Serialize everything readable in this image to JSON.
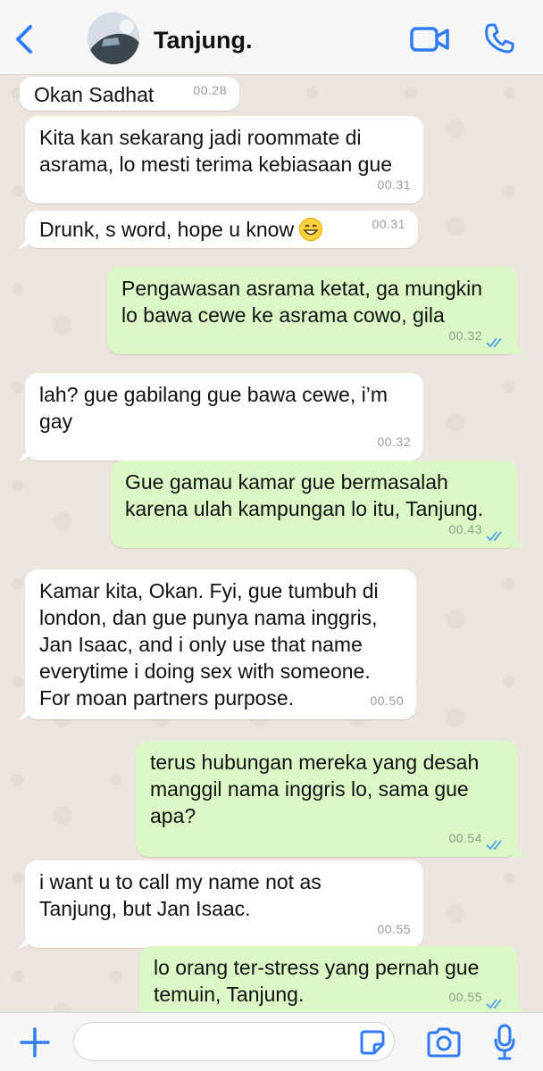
{
  "header": {
    "title": "Tanjung.",
    "back_icon": "chevron-left-icon",
    "video_icon": "video-camera-icon",
    "call_icon": "phone-icon"
  },
  "colors": {
    "accent": "#2f7cf6",
    "incoming_bubble": "#ffffff",
    "outgoing_bubble": "#dcf8c6",
    "chat_background": "#ece5dd"
  },
  "messages": [
    {
      "direction": "in",
      "text": "Okan Sadhat",
      "time": "00.28"
    },
    {
      "direction": "in",
      "text": "Kita kan sekarang jadi roommate di\nasrama, lo mesti terima kebiasaan gue",
      "time": "00.31"
    },
    {
      "direction": "in",
      "text": "Drunk, s word, hope u know",
      "emoji": "grinning-face-emoji",
      "time": "00.31"
    },
    {
      "direction": "out",
      "text": "Pengawasan asrama ketat, ga mungkin\nlo bawa cewe ke asrama cowo, gila",
      "time": "00.32",
      "read": true
    },
    {
      "direction": "in",
      "text": "lah? gue gabilang gue bawa cewe, i’m\ngay",
      "time": "00.32"
    },
    {
      "direction": "out",
      "text": "Gue gamau kamar gue bermasalah\nkarena ulah kampungan lo itu, Tanjung.",
      "time": "00.43",
      "read": true
    },
    {
      "direction": "in",
      "text": "Kamar kita, Okan. Fyi, gue tumbuh di\nlondon, dan gue punya nama inggris,\nJan Isaac, and i only use that name\neverytime i doing sex with someone.\nFor moan partners purpose.",
      "time": "00.50"
    },
    {
      "direction": "out",
      "text": "terus hubungan mereka yang desah\nmanggil nama inggris lo, sama gue\napa?",
      "time": "00.54",
      "read": true
    },
    {
      "direction": "in",
      "text": "i want u to call my name not as\nTanjung, but Jan Isaac.",
      "time": "00.55"
    },
    {
      "direction": "out",
      "text": "lo orang ter-stress yang pernah gue\ntemuin, Tanjung.",
      "time": "00.55",
      "read": true
    }
  ],
  "input_bar": {
    "plus_icon": "plus-icon",
    "message_value": "",
    "sticker_icon": "sticker-icon",
    "camera_icon": "camera-icon",
    "mic_icon": "microphone-icon"
  }
}
